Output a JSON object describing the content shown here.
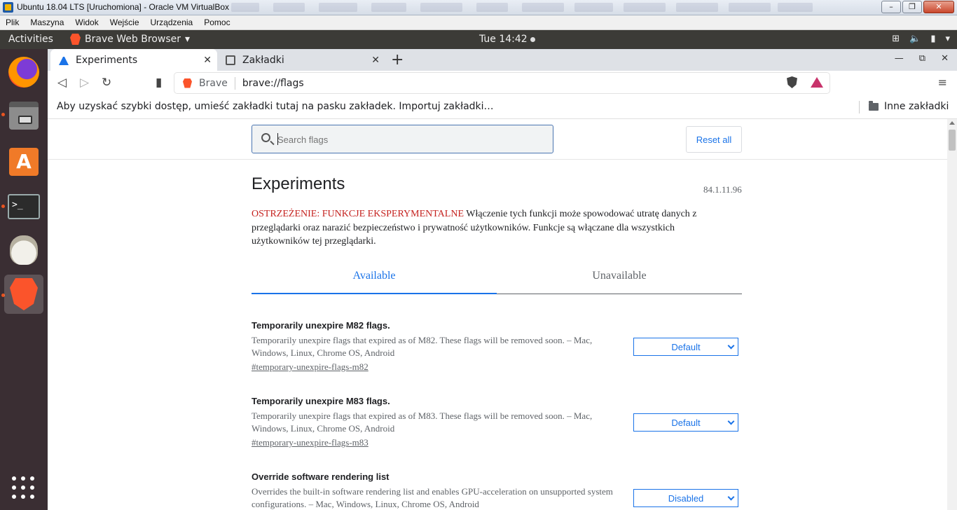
{
  "vbox": {
    "title": "Ubuntu 18.04 LTS [Uruchomiona] - Oracle VM VirtualBox",
    "menu": [
      "Plik",
      "Maszyna",
      "Widok",
      "Wejście",
      "Urządzenia",
      "Pomoc"
    ],
    "minimize": "–",
    "restore": "❐",
    "close": "✕"
  },
  "panel": {
    "activities": "Activities",
    "app_name": "Brave Web Browser",
    "app_arrow": "▾",
    "clock": "Tue 14:42",
    "tray_network": "⊞",
    "tray_sound": "🔈",
    "tray_battery": "▮",
    "tray_arrow": "▾"
  },
  "dock": {
    "items": [
      "firefox-icon",
      "files-icon",
      "software-store-icon",
      "terminal-icon",
      "gimp-icon",
      "brave-icon"
    ]
  },
  "browser": {
    "tabs": [
      {
        "label": "Experiments",
        "icon": "flask-icon",
        "active": true
      },
      {
        "label": "Zakładki",
        "icon": "bookmark-tab-icon",
        "active": false
      }
    ],
    "tab_close": "✕",
    "new_tab": "+",
    "win_min": "—",
    "win_max": "⧉",
    "win_close": "✕",
    "nav": {
      "back": "◁",
      "forward": "▷",
      "reload": "↻",
      "bookmark": "▮"
    },
    "omnibox": {
      "scheme": "Brave",
      "url": "brave://flags"
    },
    "menu": "≡",
    "bookmarks_bar": {
      "hint": "Aby uzyskać szybki dostęp, umieść zakładki tutaj na pasku zakładek. Importuj zakładki…",
      "other": "Inne zakładki"
    }
  },
  "flags_page": {
    "search_placeholder": "Search flags",
    "reset_all": "Reset all",
    "title": "Experiments",
    "version": "84.1.11.96",
    "warning_label": "OSTRZEŻENIE: FUNKCJE EKSPERYMENTALNE",
    "warning_text": " Włączenie tych funkcji może spowodować utratę danych z przeglądarki oraz narazić bezpieczeństwo i prywatność użytkowników. Funkcje są włączane dla wszystkich użytkowników tej przeglądarki.",
    "tab_available": "Available",
    "tab_unavailable": "Unavailable",
    "flags": [
      {
        "name": "Temporarily unexpire M82 flags.",
        "description": "Temporarily unexpire flags that expired as of M82. These flags will be removed soon. – Mac, Windows, Linux, Chrome OS, Android",
        "link": "#temporary-unexpire-flags-m82",
        "value": "Default"
      },
      {
        "name": "Temporarily unexpire M83 flags.",
        "description": "Temporarily unexpire flags that expired as of M83. These flags will be removed soon. – Mac, Windows, Linux, Chrome OS, Android",
        "link": "#temporary-unexpire-flags-m83",
        "value": "Default"
      },
      {
        "name": "Override software rendering list",
        "description": "Overrides the built-in software rendering list and enables GPU-acceleration on unsupported system configurations. – Mac, Windows, Linux, Chrome OS, Android",
        "link": "",
        "value": "Disabled"
      }
    ]
  },
  "colors": {
    "accent": "#1a73e8",
    "warning": "#c5221f",
    "ubuntu_orange": "#e95420",
    "brave_orange": "#fb542b"
  }
}
